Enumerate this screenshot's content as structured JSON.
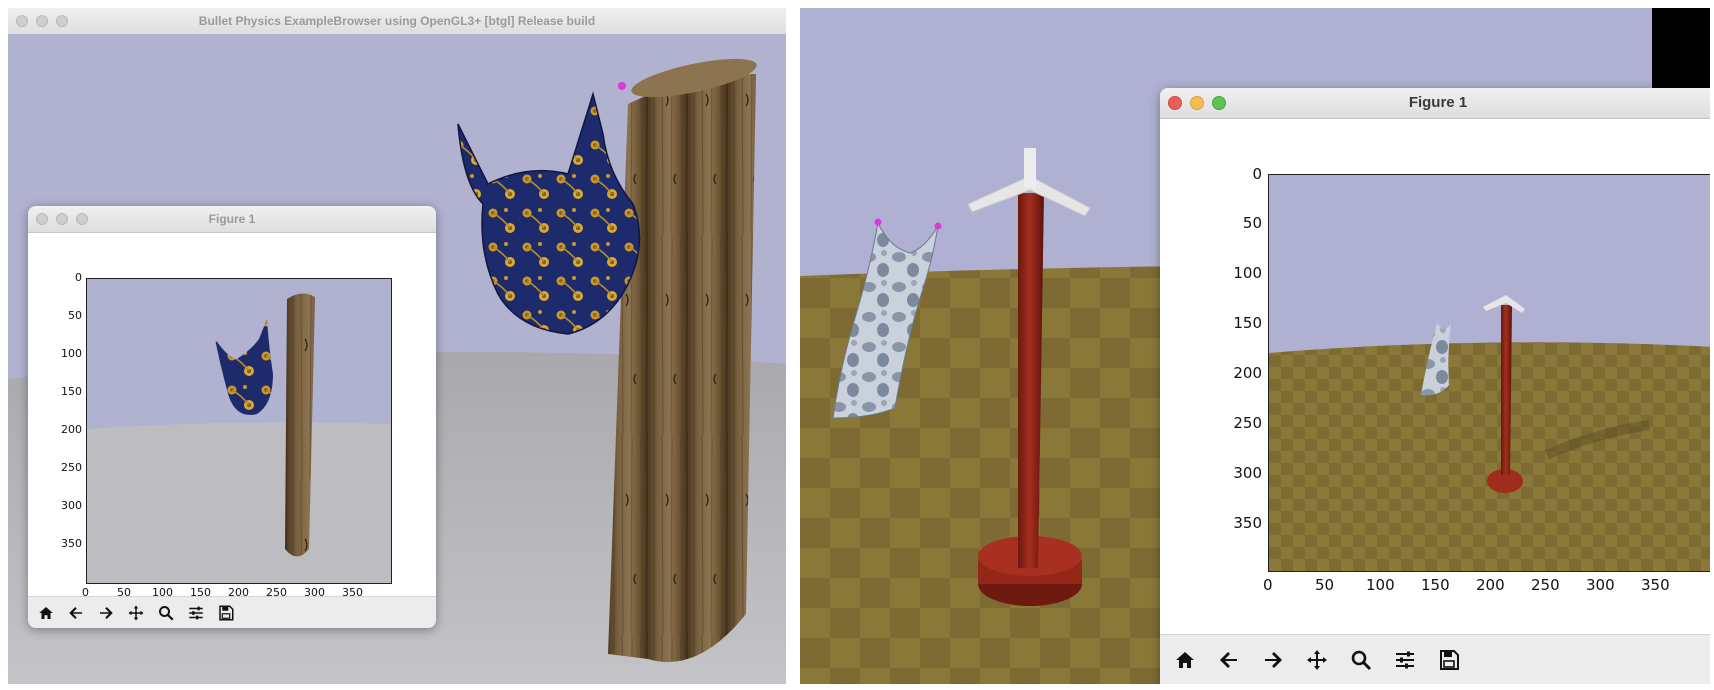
{
  "left_window": {
    "title": "Bullet Physics ExampleBrowser using OpenGL3+ [btgl] Release build",
    "figure": {
      "title": "Figure 1",
      "x_ticks": [
        "0",
        "50",
        "100",
        "150",
        "200",
        "250",
        "300",
        "350"
      ],
      "y_ticks": [
        "0",
        "50",
        "100",
        "150",
        "200",
        "250",
        "300",
        "350"
      ]
    }
  },
  "right_window": {
    "figure": {
      "title": "Figure 1",
      "x_ticks": [
        "0",
        "50",
        "100",
        "150",
        "200",
        "250",
        "300",
        "350"
      ],
      "y_ticks": [
        "0",
        "50",
        "100",
        "150",
        "200",
        "250",
        "300",
        "350"
      ]
    }
  },
  "toolbar_icons": [
    "home-icon",
    "back-arrow-icon",
    "forward-arrow-icon",
    "pan-move-icon",
    "zoom-magnifier-icon",
    "configure-subplots-icon",
    "save-icon"
  ],
  "colors": {
    "sky_left": "#b1b1d0",
    "sky_right": "#b0b0d2",
    "ground_gray": "#b9b9bd",
    "ground_checker": "#7a6a32",
    "wood": "#6f5838",
    "cloth_blue": "#1d2a6b",
    "cloth_gold": "#c8992a",
    "pole_red": "#8c2417",
    "dress_light": "#c9d2dc",
    "anchor_magenta": "#d93ad9"
  }
}
